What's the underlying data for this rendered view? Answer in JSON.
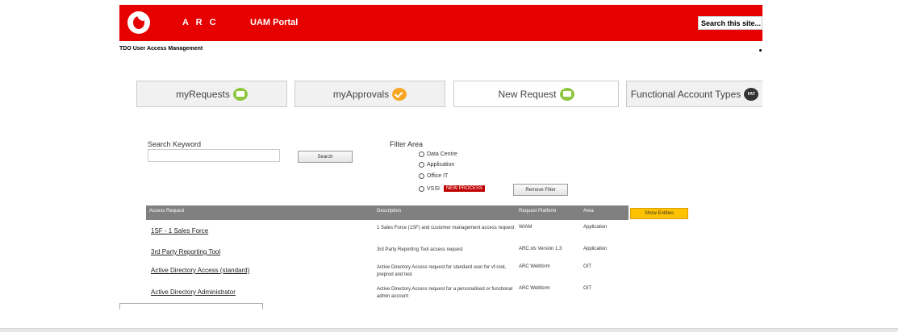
{
  "header": {
    "arc_label": "A R C",
    "portal_label": "UAM Portal",
    "search_placeholder": "Search this site..."
  },
  "subtitle": "TDO User Access Management",
  "tabs": [
    {
      "label": "myRequests",
      "icon": "envelope-icon"
    },
    {
      "label": "myApprovals",
      "icon": "checkmark-icon"
    },
    {
      "label": "New Request",
      "icon": "new-envelope-icon"
    },
    {
      "label": "Functional Account Types",
      "icon": "fat-icon",
      "icon_text": "FAT"
    }
  ],
  "search": {
    "label": "Search Keyword",
    "value": "",
    "button": "Search"
  },
  "filter": {
    "label": "Filter Area",
    "options": [
      "Data Centre",
      "Application",
      "Office IT",
      "VSSI"
    ],
    "new_badge": "NEW PROCESS",
    "remove_button": "Remove Filter"
  },
  "table": {
    "headers": [
      "Access Request",
      "Description",
      "Request Platform",
      "Area"
    ],
    "show_entities": "Show Entities",
    "rows": [
      {
        "name": "1SF - 1 Sales Force",
        "desc": "1 Sales Force (1SF) and customer management access request",
        "platform": "WIAM",
        "area": "Application"
      },
      {
        "name": "3rd Party Reporting Tool",
        "desc": "3rd Party Reporting Tool access request",
        "platform": "ARC.xls Version 1.3",
        "area": "Application"
      },
      {
        "name": "Active Directory Access (standard)",
        "desc": "Active Directory Access request for standard user for vf-root, preprod and test",
        "platform": "ARC Webform",
        "area": "OIT"
      },
      {
        "name": "Active Directory Administrator",
        "desc": "Active Directory Access request for a personalised or functional admin account",
        "platform": "ARC Webform",
        "area": "OIT"
      }
    ]
  },
  "colors": {
    "brand_red": "#e60000",
    "badge_red": "#c00000",
    "show_button": "#ffc200",
    "table_header": "#808080"
  }
}
